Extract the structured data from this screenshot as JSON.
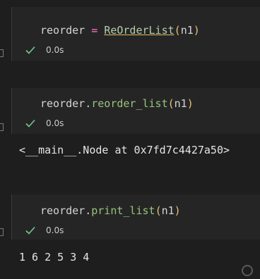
{
  "cells": [
    {
      "code": {
        "target": "reorder",
        "op": "=",
        "cls": "ReOrderList",
        "lp": "(",
        "arg": "n1",
        "rp": ")"
      },
      "status": {
        "time": "0.0s",
        "icon": "check-icon"
      }
    },
    {
      "code": {
        "obj": "reorder",
        "dot": ".",
        "method": "reorder_list",
        "lp": "(",
        "arg": "n1",
        "rp": ")"
      },
      "status": {
        "time": "0.0s",
        "icon": "check-icon"
      },
      "output": "<__main__.Node at 0x7fd7c4427a50>"
    },
    {
      "code": {
        "obj": "reorder",
        "dot": ".",
        "method": "print_list",
        "lp": "(",
        "arg": "n1",
        "rp": ")"
      },
      "status": {
        "time": "0.0s",
        "icon": "check-icon"
      },
      "output": "1 6 2 5 3 4"
    }
  ],
  "colors": {
    "background": "#1e1e1e",
    "cell_background": "#252526",
    "keyword": "#ff79c6",
    "method": "#98c379",
    "paren": "#e5c07b",
    "check": "#73c991"
  },
  "watermark": {
    "icon": "watermark-logo-icon"
  }
}
